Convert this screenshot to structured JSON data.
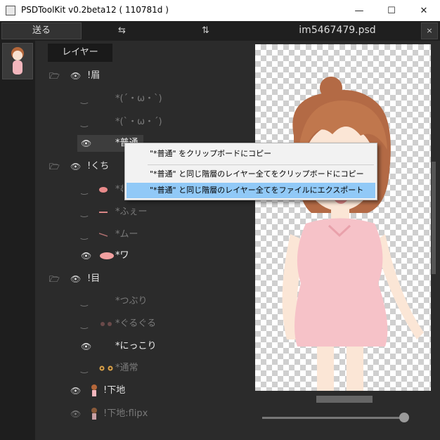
{
  "window": {
    "title": "PSDToolKit v0.2beta12 ( 110781d )",
    "minimize": "—",
    "maximize": "☐",
    "close": "✕"
  },
  "toolbar": {
    "send_label": "送る",
    "swap_h_icon": "⇆",
    "swap_v_icon": "⇅",
    "filename": "im5467479.psd",
    "close_label": "×"
  },
  "layers_header": "レイヤー",
  "icons": {
    "folder": "🗁",
    "eye": "👁",
    "eye_hidden": "‿"
  },
  "layers": [
    {
      "name": "!眉",
      "type": "folder",
      "visible": true,
      "dim": false
    },
    {
      "name": "*(´・ω・`)",
      "type": "item",
      "visible": false,
      "dim": true
    },
    {
      "name": "*(`・ω・´)",
      "type": "item",
      "visible": false,
      "dim": true
    },
    {
      "name": "*普通",
      "type": "item",
      "visible": true,
      "dim": false,
      "selected": true
    },
    {
      "name": "!くち",
      "type": "folder",
      "visible": true,
      "dim": false
    },
    {
      "name": "*むぅ",
      "type": "item",
      "visible": false,
      "dim": true
    },
    {
      "name": "*ふぇー",
      "type": "item",
      "visible": false,
      "dim": true
    },
    {
      "name": "*ムー",
      "type": "item",
      "visible": false,
      "dim": true
    },
    {
      "name": "*ワ",
      "type": "item",
      "visible": true,
      "dim": false
    },
    {
      "name": "!目",
      "type": "folder",
      "visible": true,
      "dim": false
    },
    {
      "name": "*つぶり",
      "type": "item",
      "visible": false,
      "dim": true
    },
    {
      "name": "*ぐるぐる",
      "type": "item",
      "visible": false,
      "dim": true
    },
    {
      "name": "*にっこり",
      "type": "item",
      "visible": true,
      "dim": false
    },
    {
      "name": "*通常",
      "type": "item",
      "visible": false,
      "dim": true
    },
    {
      "name": "!下地",
      "type": "layer",
      "visible": true,
      "dim": false
    },
    {
      "name": "!下地:flipx",
      "type": "layer",
      "visible": true,
      "dim": true
    }
  ],
  "context_menu": {
    "items": [
      {
        "label": "\"*普通\" をクリップボードにコピー",
        "highlighted": false
      },
      {
        "label": "\"*普通\" と同じ階層のレイヤー全てをクリップボードにコピー",
        "highlighted": false
      },
      {
        "label": "\"*普通\" と同じ階層のレイヤー全てをファイルにエクスポート",
        "highlighted": true
      }
    ]
  },
  "zoom_slider": {
    "value": 1.0
  },
  "colors": {
    "bg": "#2b2b2b",
    "panel": "#1e1e1e",
    "highlight": "#91c9f7",
    "text": "#dddddd",
    "dim_text": "#7a7a7a"
  }
}
